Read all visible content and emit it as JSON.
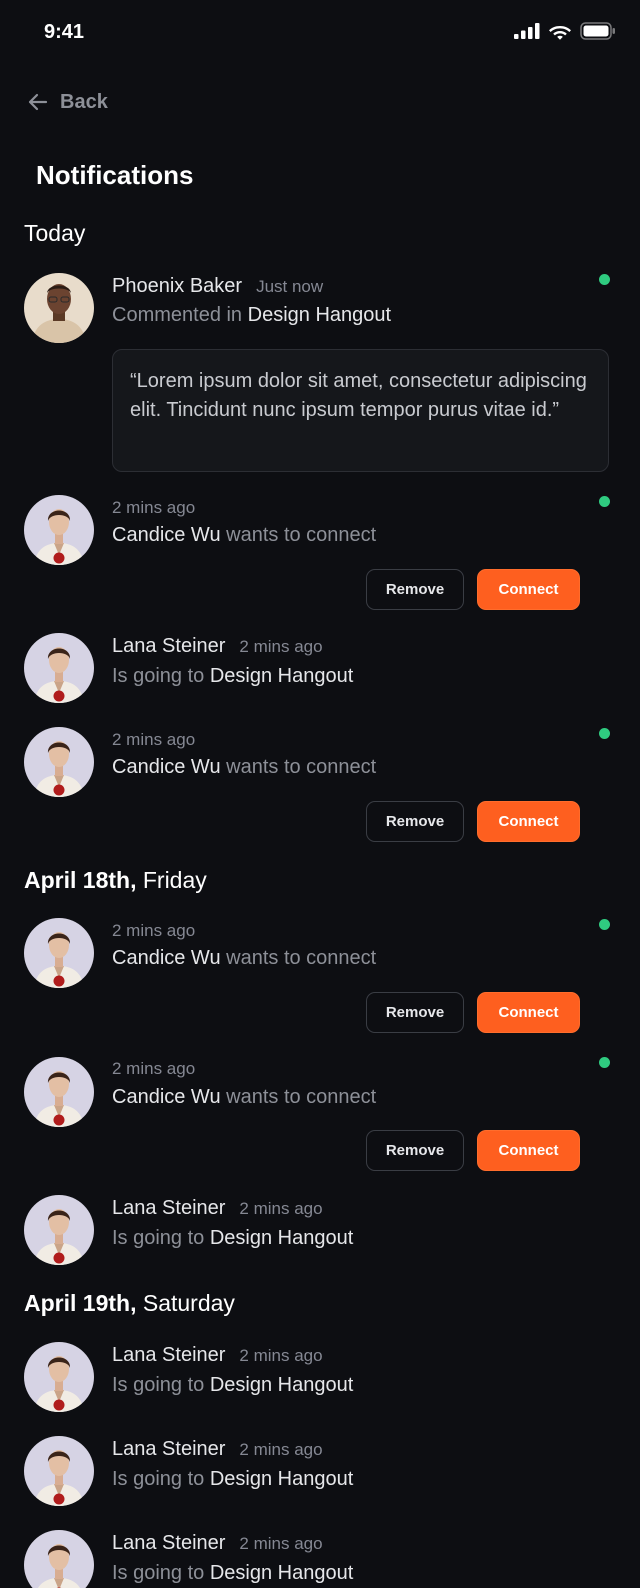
{
  "status_bar": {
    "time": "9:41"
  },
  "nav": {
    "back_label": "Back"
  },
  "page": {
    "title": "Notifications"
  },
  "sections": {
    "today": {
      "label": "Today"
    },
    "april18": {
      "bold": "April 18th,",
      "rest": " Friday"
    },
    "april19": {
      "bold": "April 19th,",
      "rest": " Saturday"
    }
  },
  "notifications": {
    "n1": {
      "name": "Phoenix Baker",
      "time": "Just now",
      "action": "Commented in ",
      "target": "Design Hangout",
      "quote": "“Lorem ipsum dolor sit amet, consectetur adipiscing elit. Tincidunt nunc ipsum tempor purus vitae id.”",
      "unread": true
    },
    "n2": {
      "time": "2 mins ago",
      "name": "Candice Wu",
      "action": " wants to connect",
      "unread": true
    },
    "n3": {
      "name": "Lana Steiner",
      "time": "2 mins ago",
      "action": "Is going to ",
      "target": "Design Hangout"
    },
    "n4": {
      "time": "2 mins ago",
      "name": "Candice Wu",
      "action": " wants to connect",
      "unread": true
    },
    "n5": {
      "time": "2 mins ago",
      "name": "Candice Wu",
      "action": " wants to connect",
      "unread": true
    },
    "n6": {
      "time": "2 mins ago",
      "name": "Candice Wu",
      "action": " wants to connect",
      "unread": true
    },
    "n7": {
      "name": "Lana Steiner",
      "time": "2 mins ago",
      "action": "Is going to ",
      "target": "Design Hangout"
    },
    "n8": {
      "name": "Lana Steiner",
      "time": "2 mins ago",
      "action": "Is going to ",
      "target": "Design Hangout"
    },
    "n9": {
      "name": "Lana Steiner",
      "time": "2 mins ago",
      "action": "Is going to ",
      "target": "Design Hangout"
    },
    "n10": {
      "name": "Lana Steiner",
      "time": "2 mins ago",
      "action": "Is going to ",
      "target": "Design Hangout"
    }
  },
  "buttons": {
    "remove": "Remove",
    "connect": "Connect"
  },
  "colors": {
    "background": "#0d0e12",
    "accent": "#fe5f1f",
    "unread_dot": "#2fcb80",
    "muted_text": "#8d9098"
  },
  "icons": [
    "cellular-signal-icon",
    "wifi-icon",
    "battery-icon",
    "arrow-left-icon"
  ]
}
